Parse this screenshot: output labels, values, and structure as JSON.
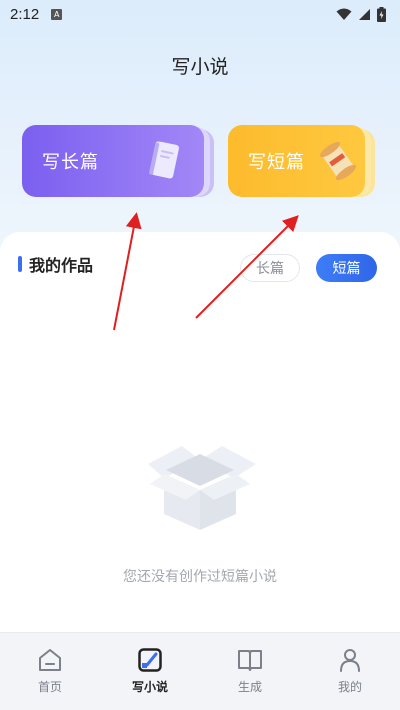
{
  "status_bar": {
    "time": "2:12",
    "notification_letter": "A"
  },
  "header": {
    "title": "写小说"
  },
  "write_cards": {
    "long": {
      "label": "写长篇",
      "icon": "book-icon"
    },
    "short": {
      "label": "写短篇",
      "icon": "scroll-icon"
    }
  },
  "works": {
    "title": "我的作品",
    "tabs": [
      {
        "label": "长篇",
        "active": false
      },
      {
        "label": "短篇",
        "active": true
      }
    ],
    "empty_text": "您还没有创作过短篇小说"
  },
  "nav": {
    "items": [
      {
        "label": "首页",
        "icon": "home-icon",
        "active": false
      },
      {
        "label": "写小说",
        "icon": "write-icon",
        "active": true
      },
      {
        "label": "生成",
        "icon": "open-book-icon",
        "active": false
      },
      {
        "label": "我的",
        "icon": "person-icon",
        "active": false
      }
    ]
  },
  "colors": {
    "accent_blue": "#2f66e8",
    "long_card": "#7b5ff0",
    "short_card": "#fdbb2d",
    "annotation_arrow": "#e02020"
  }
}
